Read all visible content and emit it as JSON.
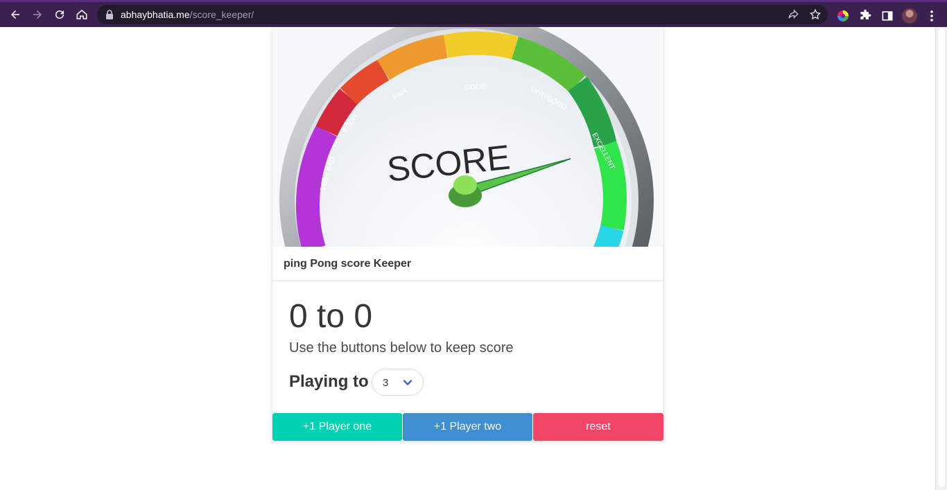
{
  "browser": {
    "url_host": "abhaybhatia.me",
    "url_path": "/score_keeper/",
    "nav_icons": [
      "back-icon",
      "forward-icon",
      "reload-icon",
      "home-icon"
    ],
    "omnibox_icons": [
      "lock-icon",
      "share-icon",
      "star-icon"
    ],
    "toolbar_icons": [
      "color-extension-icon",
      "puzzle-icon",
      "side-panel-icon",
      "avatar",
      "kebab-menu-icon"
    ]
  },
  "card": {
    "image": {
      "gauge_word": "SCORE",
      "segment_labels": [
        "VERY BAD",
        "POOR",
        "FAIR",
        "GOOD",
        "VERYGOOD",
        "EXCELLENT"
      ]
    },
    "title": "ping Pong score Keeper",
    "score_display": "0 to 0",
    "instructions": "Use the buttons below to keep score",
    "playing_to_label": "Playing to",
    "playing_to_value": "3",
    "buttons": {
      "player_one": "+1 Player one",
      "player_two": "+1 Player two",
      "reset": "reset"
    }
  },
  "colors": {
    "player_one": "#00d1b2",
    "player_two": "#3e8ed0",
    "reset": "#f14668",
    "browser_frame": "#3b2150"
  }
}
